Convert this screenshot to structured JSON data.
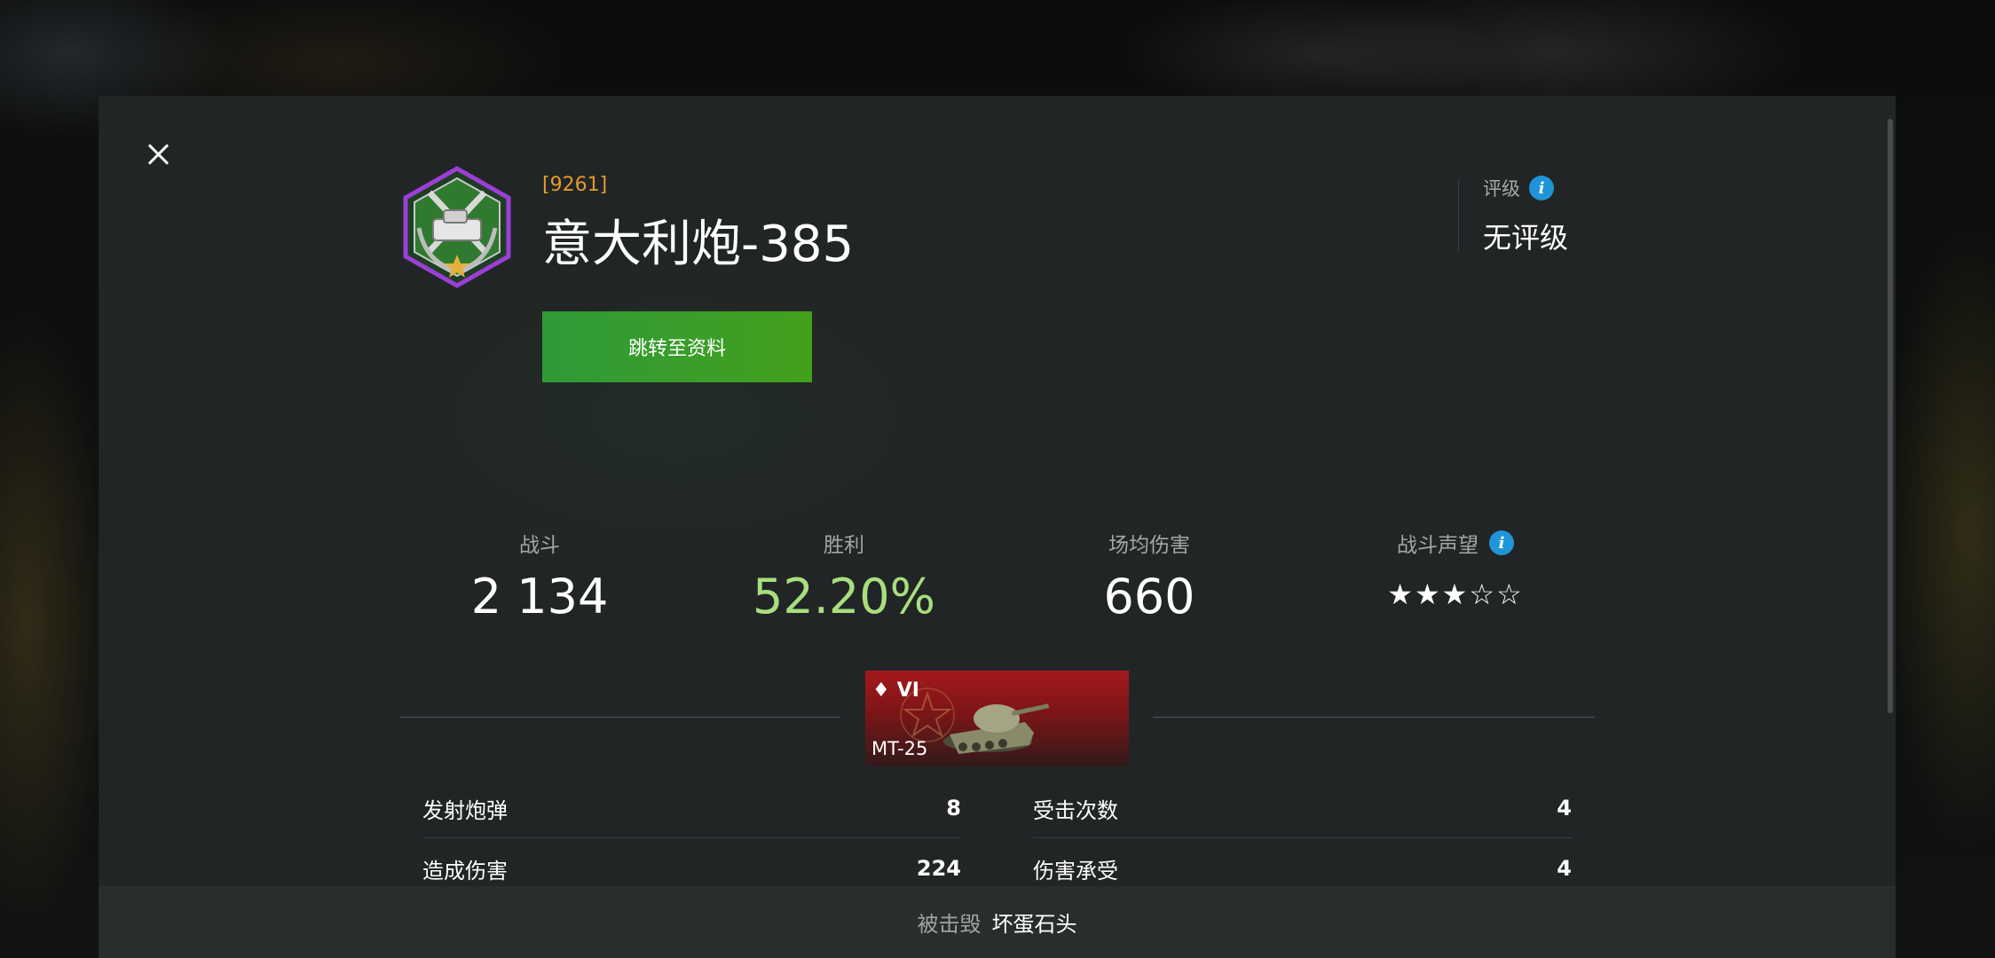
{
  "header": {
    "clan_tag": "[9261]",
    "player_name": "意大利炮-385",
    "profile_button_label": "跳转至资料",
    "rating_label": "评级",
    "rating_value": "无评级"
  },
  "stats": {
    "battles_label": "战斗",
    "battles_value": "2 134",
    "victories_label": "胜利",
    "victories_value": "52.20%",
    "avg_damage_label": "场均伤害",
    "avg_damage_value": "660",
    "reputation_label": "战斗声望",
    "reputation_stars": "★★★☆☆",
    "reputation_level": 3,
    "reputation_max": 5
  },
  "tank": {
    "tier": "VI",
    "name": "MT-25",
    "nation_color": "#a4191d"
  },
  "battle_details": [
    {
      "label": "发射炮弹",
      "value": "8"
    },
    {
      "label": "受击次数",
      "value": "4"
    },
    {
      "label": "造成伤害",
      "value": "224"
    },
    {
      "label": "伤害承受",
      "value": "4"
    }
  ],
  "footer": {
    "destroyed_by_label": "被击毁",
    "destroyed_by_name": "坏蛋石头"
  },
  "icons": {
    "close": "close-icon",
    "info": "info-icon",
    "clan": "clan-emblem-icon",
    "premium": "diamond-icon"
  },
  "colors": {
    "clan_tag": "#e39b2b",
    "win_rate": "#a9de7e",
    "button_green": "#3a9d2a",
    "info_blue": "#1f95d8"
  }
}
